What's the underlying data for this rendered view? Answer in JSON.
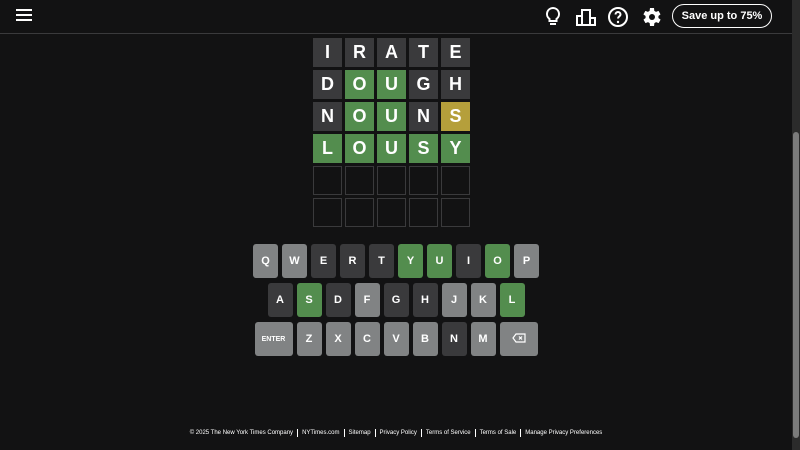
{
  "header": {
    "save_label": "Save up to 75%",
    "icons": [
      "menu-icon",
      "lightbulb-icon",
      "leaderboard-icon",
      "help-icon",
      "gear-icon"
    ]
  },
  "colors": {
    "background": "#121213",
    "correct": "#538d4e",
    "present": "#b59f3b",
    "absent": "#3a3a3c",
    "unused": "#818384"
  },
  "board": {
    "rows": [
      [
        {
          "letter": "I",
          "state": "absent"
        },
        {
          "letter": "R",
          "state": "absent"
        },
        {
          "letter": "A",
          "state": "absent"
        },
        {
          "letter": "T",
          "state": "absent"
        },
        {
          "letter": "E",
          "state": "absent"
        }
      ],
      [
        {
          "letter": "D",
          "state": "absent"
        },
        {
          "letter": "O",
          "state": "correct"
        },
        {
          "letter": "U",
          "state": "correct"
        },
        {
          "letter": "G",
          "state": "absent"
        },
        {
          "letter": "H",
          "state": "absent"
        }
      ],
      [
        {
          "letter": "N",
          "state": "absent"
        },
        {
          "letter": "O",
          "state": "correct"
        },
        {
          "letter": "U",
          "state": "correct"
        },
        {
          "letter": "N",
          "state": "absent"
        },
        {
          "letter": "S",
          "state": "present"
        }
      ],
      [
        {
          "letter": "L",
          "state": "correct"
        },
        {
          "letter": "O",
          "state": "correct"
        },
        {
          "letter": "U",
          "state": "correct"
        },
        {
          "letter": "S",
          "state": "correct"
        },
        {
          "letter": "Y",
          "state": "correct"
        }
      ],
      [
        {
          "letter": "",
          "state": "empty"
        },
        {
          "letter": "",
          "state": "empty"
        },
        {
          "letter": "",
          "state": "empty"
        },
        {
          "letter": "",
          "state": "empty"
        },
        {
          "letter": "",
          "state": "empty"
        }
      ],
      [
        {
          "letter": "",
          "state": "empty"
        },
        {
          "letter": "",
          "state": "empty"
        },
        {
          "letter": "",
          "state": "empty"
        },
        {
          "letter": "",
          "state": "empty"
        },
        {
          "letter": "",
          "state": "empty"
        }
      ]
    ]
  },
  "keyboard": {
    "rows": [
      [
        {
          "key": "Q",
          "state": "unused"
        },
        {
          "key": "W",
          "state": "unused"
        },
        {
          "key": "E",
          "state": "absent"
        },
        {
          "key": "R",
          "state": "absent"
        },
        {
          "key": "T",
          "state": "absent"
        },
        {
          "key": "Y",
          "state": "correct"
        },
        {
          "key": "U",
          "state": "correct"
        },
        {
          "key": "I",
          "state": "absent"
        },
        {
          "key": "O",
          "state": "correct"
        },
        {
          "key": "P",
          "state": "unused"
        }
      ],
      [
        {
          "key": "A",
          "state": "absent"
        },
        {
          "key": "S",
          "state": "correct"
        },
        {
          "key": "D",
          "state": "absent"
        },
        {
          "key": "F",
          "state": "unused"
        },
        {
          "key": "G",
          "state": "absent"
        },
        {
          "key": "H",
          "state": "absent"
        },
        {
          "key": "J",
          "state": "unused"
        },
        {
          "key": "K",
          "state": "unused"
        },
        {
          "key": "L",
          "state": "correct"
        }
      ],
      [
        {
          "key": "ENTER",
          "state": "unused",
          "wide": true
        },
        {
          "key": "Z",
          "state": "unused"
        },
        {
          "key": "X",
          "state": "unused"
        },
        {
          "key": "C",
          "state": "unused"
        },
        {
          "key": "V",
          "state": "unused"
        },
        {
          "key": "B",
          "state": "unused"
        },
        {
          "key": "N",
          "state": "absent"
        },
        {
          "key": "M",
          "state": "unused"
        },
        {
          "key": "",
          "state": "unused",
          "wide": true,
          "icon": "backspace-icon"
        }
      ]
    ]
  },
  "footer": {
    "copyright": "© 2025 The New York Times Company",
    "links": [
      "NYTimes.com",
      "Sitemap",
      "Privacy Policy",
      "Terms of Service",
      "Terms of Sale",
      "Manage Privacy Preferences"
    ]
  }
}
